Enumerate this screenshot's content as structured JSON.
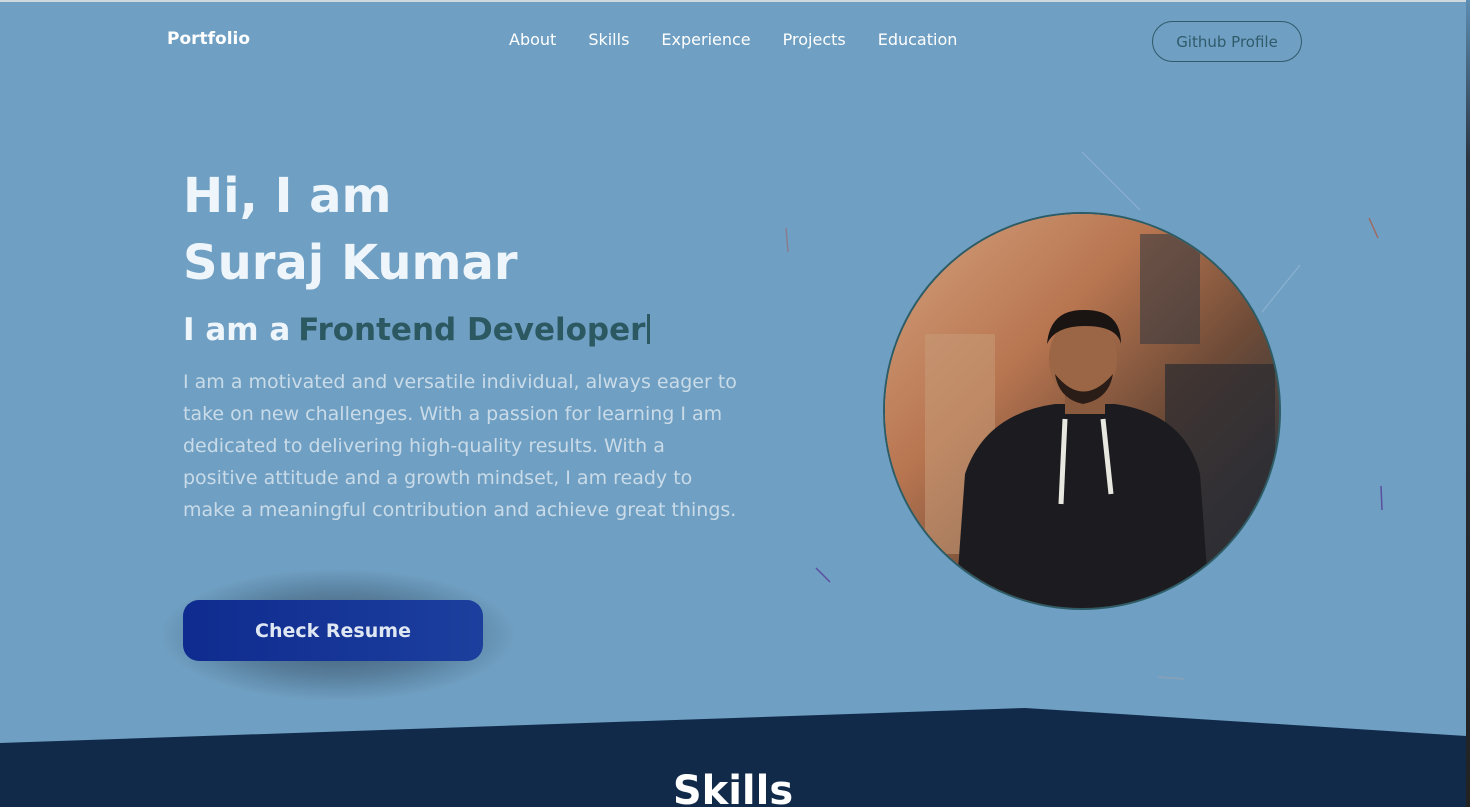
{
  "nav": {
    "brand": "Portfolio",
    "links": [
      "About",
      "Skills",
      "Experience",
      "Projects",
      "Education"
    ],
    "github_label": "Github Profile"
  },
  "hero": {
    "greeting": "Hi, I am",
    "name": "Suraj Kumar",
    "role_prefix": "I am a",
    "role_typed": "Frontend Developer",
    "bio": "I am a motivated and versatile individual, always eager to take on new challenges. With a passion for learning I am dedicated to delivering high-quality results. With a positive attitude and a growth mindset, I am ready to make a meaningful contribution and achieve great things.",
    "resume_label": "Check Resume"
  },
  "skills": {
    "title": "Skills"
  },
  "colors": {
    "background": "#6f9fc2",
    "dark_band": "#112a4a",
    "accent": "#2c5862",
    "button": "#0f2b8f"
  }
}
